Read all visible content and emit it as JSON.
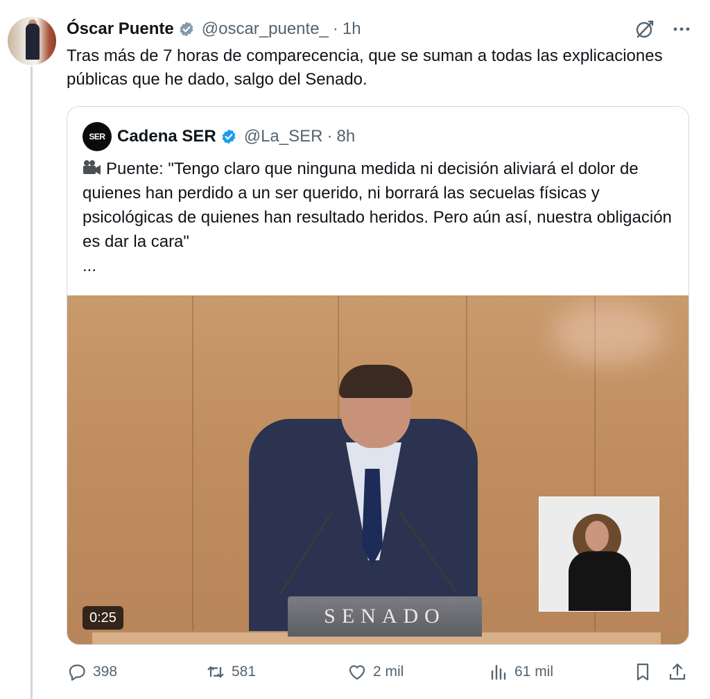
{
  "tweet": {
    "author_name": "Óscar Puente",
    "author_handle": "@oscar_puente_",
    "separator": "·",
    "time": "1h",
    "text": "Tras más de 7 horas de comparecencia, que se suman a todas las explicaciones públicas que he dado, salgo del Senado."
  },
  "quote": {
    "author_name": "Cadena SER",
    "author_handle": "@La_SER",
    "separator": "·",
    "time": "8h",
    "logo_text": "SER",
    "text": "Puente: \"Tengo claro que ninguna medida ni decisión aliviará el dolor de quienes han perdido a un ser querido, ni borrará las secuelas físicas y psicológicas de quienes han resultado heridos. Pero aún así, nuestra obligación es dar la cara\"",
    "ellipsis": "...",
    "video": {
      "duration": "0:25",
      "podium_text": "SENADO"
    }
  },
  "actions": {
    "replies": "398",
    "reposts": "581",
    "likes": "2 mil",
    "views": "61 mil"
  },
  "colors": {
    "verified": "#1d9bf0",
    "badge_gray": "#829aab",
    "muted": "#536471",
    "border": "#cfd9de"
  },
  "icons": [
    "verified-badge-icon",
    "grok-icon",
    "more-icon",
    "video-camera-icon",
    "reply-icon",
    "repost-icon",
    "like-icon",
    "views-icon",
    "bookmark-icon",
    "share-icon"
  ]
}
